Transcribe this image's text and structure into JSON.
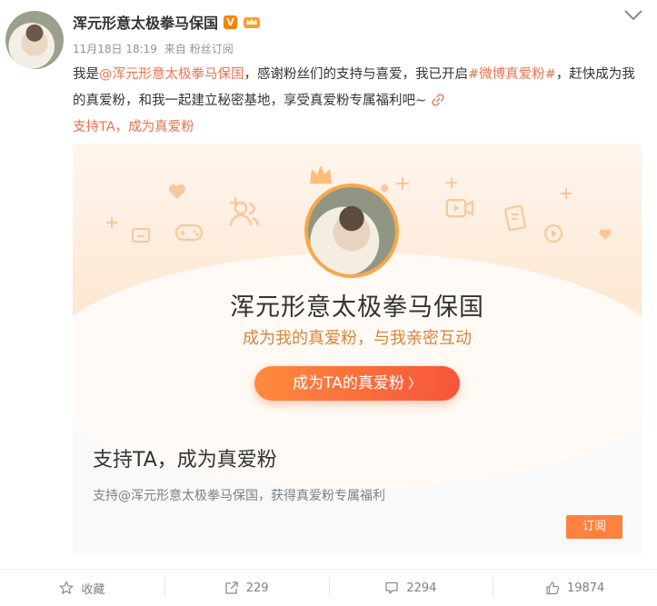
{
  "post": {
    "author_name": "浑元形意太极拳马保国",
    "verified_badge": "V",
    "date": "11月18日 18:19",
    "source_prefix": "来自",
    "source": "粉丝订阅",
    "text_prefix": "我是",
    "mention": "@浑元形意太极拳马保国",
    "text_middle": "，感谢粉丝们的支持与喜爱，我已开启",
    "hashtag": "#微博真爱粉#",
    "text_suffix": "，赶快成为我的真爱粉，和我一起建立秘密基地，享受真爱粉专属福利吧~",
    "link_text": "支持TA，成为真爱粉"
  },
  "card": {
    "title": "浑元形意太极拳马保国",
    "subtitle": "成为我的真爱粉，与我亲密互动",
    "cta_label": "成为TA的真爱粉",
    "cta_arrow": "〉",
    "footer_title": "支持TA，成为真爱粉",
    "footer_desc": "支持@浑元形意太极拳马保国，获得真爱粉专属福利",
    "subscribe_label": "订阅"
  },
  "actions": {
    "favorite_label": "收藏",
    "repost_count": "229",
    "comment_count": "2294",
    "like_count": "19874"
  },
  "colors": {
    "accent": "#eb7350",
    "button_orange": "#ff8140",
    "verified": "#ff8200"
  }
}
